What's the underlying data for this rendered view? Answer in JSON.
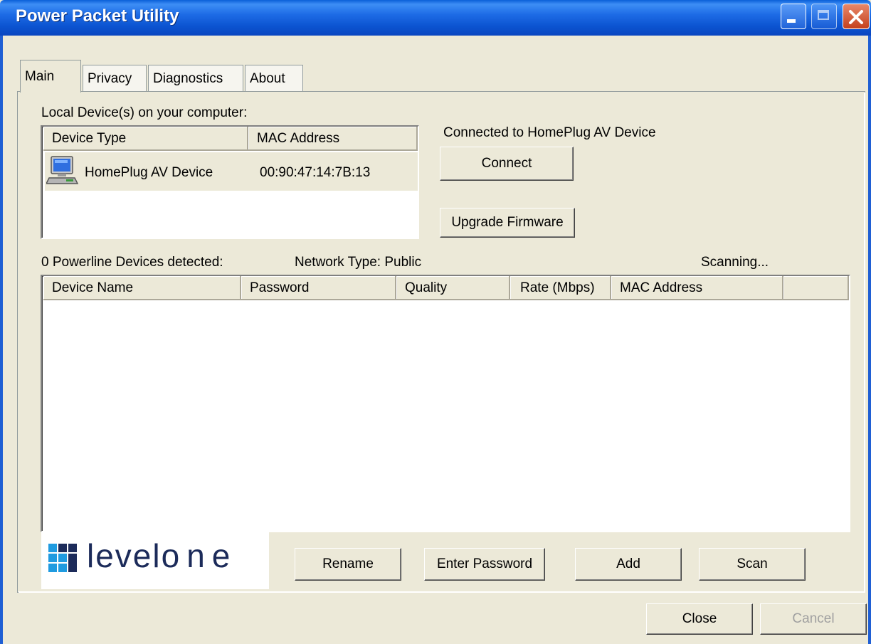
{
  "window": {
    "title": "Power Packet Utility"
  },
  "tabs": [
    {
      "label": "Main",
      "active": true
    },
    {
      "label": "Privacy",
      "active": false
    },
    {
      "label": "Diagnostics",
      "active": false
    },
    {
      "label": "About",
      "active": false
    }
  ],
  "local": {
    "label": "Local Device(s) on your computer:",
    "columns": [
      "Device Type",
      "MAC Address"
    ],
    "rows": [
      {
        "device_type": "HomePlug AV Device",
        "mac": "00:90:47:14:7B:13",
        "icon": "computer-icon"
      }
    ],
    "connected_status": "Connected to HomePlug AV Device",
    "connect_label": "Connect",
    "upgrade_label": "Upgrade Firmware"
  },
  "powerline": {
    "detected_label": "0 Powerline Devices detected:",
    "network_type": "Network Type: Public",
    "status": "Scanning...",
    "columns": [
      "Device Name",
      "Password",
      "Quality",
      "Rate (Mbps)",
      "MAC Address"
    ],
    "rows": []
  },
  "logo": {
    "part1": "level",
    "part2": "one",
    "colors": {
      "icon": "#1f9be0",
      "text": "#1c2b5a"
    }
  },
  "buttons": {
    "rename": "Rename",
    "enter_password": "Enter Password",
    "add": "Add",
    "scan": "Scan",
    "close": "Close",
    "cancel": "Cancel"
  },
  "colors": {
    "titlebar": "#0b53d0",
    "face": "#ece9d8",
    "list_border": "#7f9db9"
  }
}
